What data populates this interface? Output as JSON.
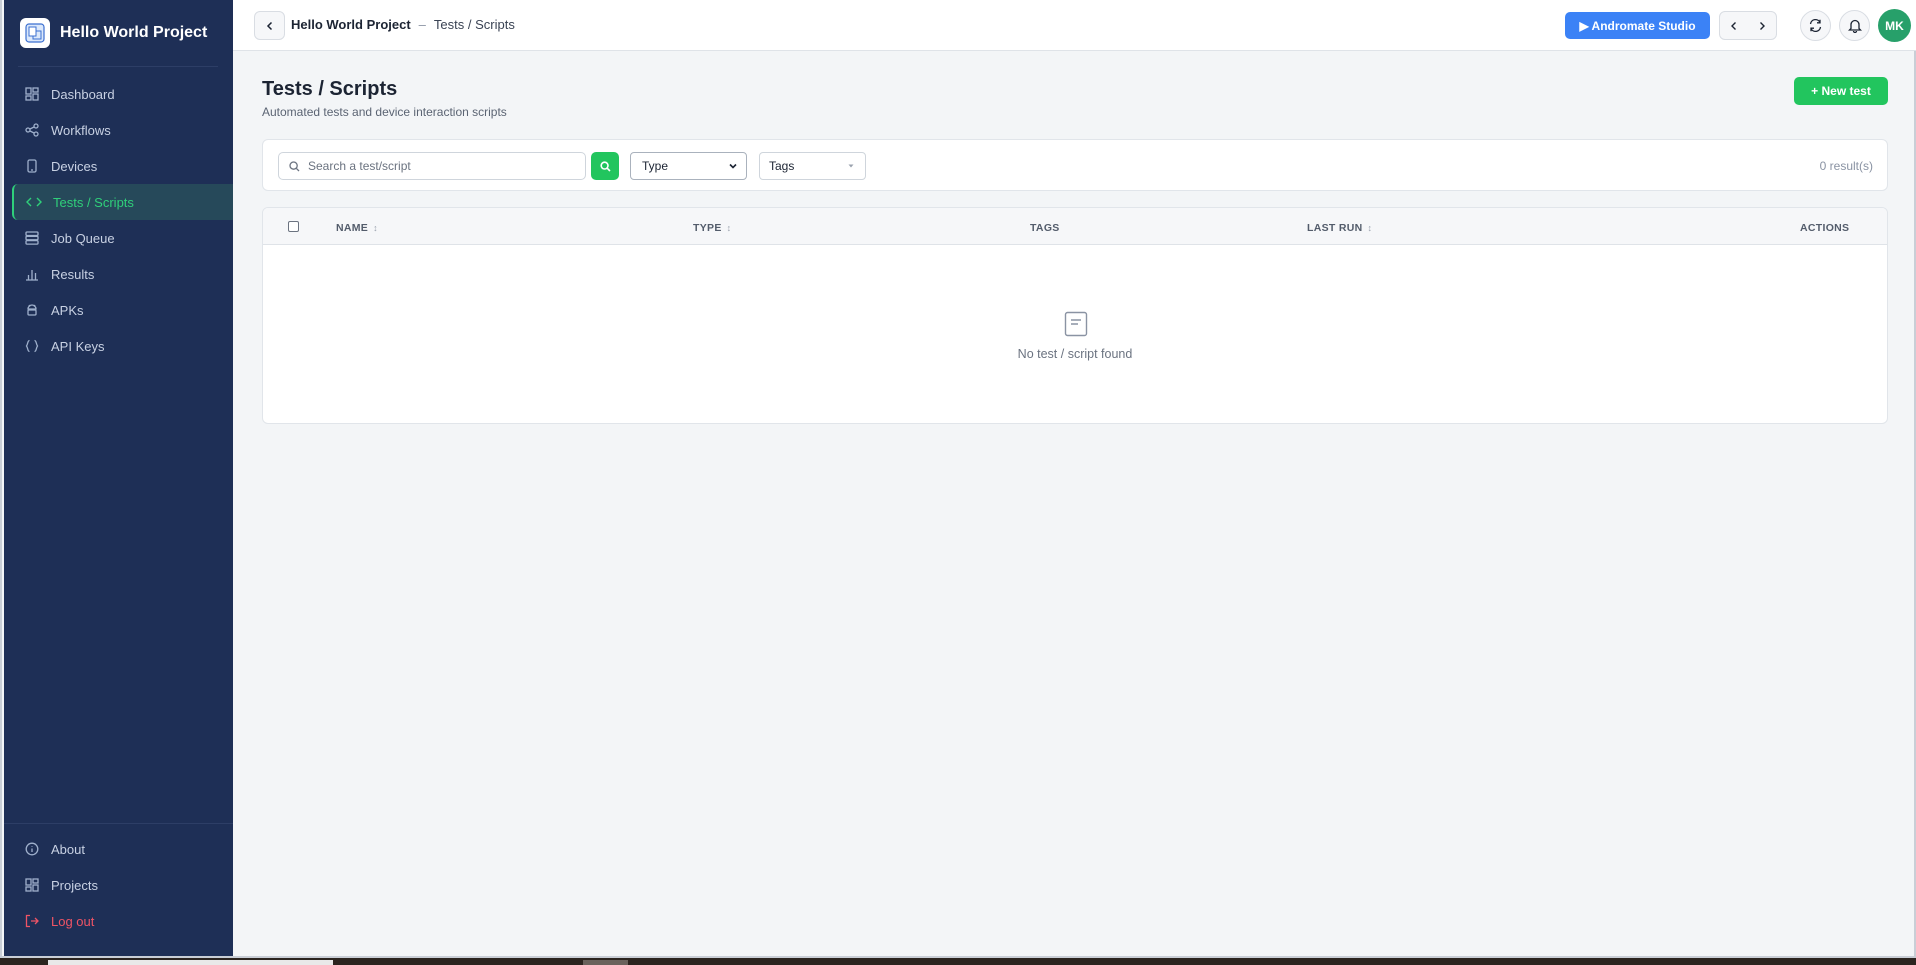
{
  "sidebar": {
    "brand": "Hello World Project",
    "items": [
      {
        "label": "Dashboard",
        "icon": "dashboard-icon"
      },
      {
        "label": "Workflows",
        "icon": "share-icon"
      },
      {
        "label": "Devices",
        "icon": "phone-icon"
      },
      {
        "label": "Tests / Scripts",
        "icon": "code-icon",
        "active": true
      },
      {
        "label": "Job Queue",
        "icon": "database-icon"
      },
      {
        "label": "Results",
        "icon": "bar-chart-icon"
      },
      {
        "label": "APKs",
        "icon": "android-icon"
      },
      {
        "label": "API Keys",
        "icon": "braces-icon"
      }
    ],
    "bottom_items": [
      {
        "label": "About",
        "icon": "info-icon"
      },
      {
        "label": "Projects",
        "icon": "grid-icon"
      },
      {
        "label": "Log out",
        "icon": "logout-icon"
      }
    ]
  },
  "header": {
    "project": "Hello World Project",
    "separator": "–",
    "page": "Tests / Scripts",
    "studio_button": "▶ Andromate Studio",
    "avatar_initials": "MK"
  },
  "main": {
    "title": "Tests / Scripts",
    "subtitle": "Automated tests and device interaction scripts",
    "new_button": "+ New test",
    "search_placeholder": "Search a test/script",
    "type_select": "Type",
    "tags_select": "Tags",
    "result_count": "0 result(s)",
    "columns": {
      "name": "NAME",
      "type": "TYPE",
      "tags": "TAGS",
      "last_run": "LAST RUN",
      "actions": "ACTIONS"
    },
    "empty_text": "No test / script found"
  },
  "colors": {
    "sidebar_bg": "#1e2f56",
    "accent_green": "#22c55e",
    "active_green": "#2fd07a",
    "studio_blue": "#3b82f6",
    "logout_red": "#ef5466"
  }
}
